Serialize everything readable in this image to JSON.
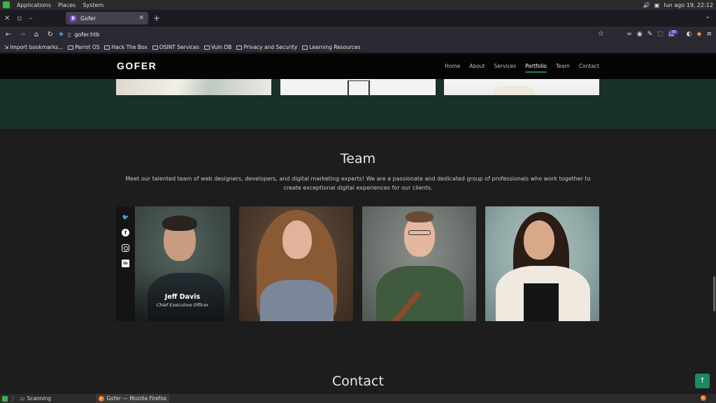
{
  "os_panel": {
    "menu": [
      "Applications",
      "Places",
      "System"
    ],
    "clock": "lun ago 19, 22:12"
  },
  "browser": {
    "tab_title": "Gofer",
    "tab_favicon": "B",
    "url": "gofer.htb",
    "extension_badge": "30",
    "bookmarks": [
      "Import bookmarks...",
      "Parrot OS",
      "Hack The Box",
      "OSINT Services",
      "Vuln DB",
      "Privacy and Security",
      "Learning Resources"
    ]
  },
  "site": {
    "logo": "GOFER",
    "nav": [
      "Home",
      "About",
      "Services",
      "Portfolio",
      "Team",
      "Contact"
    ],
    "active_nav": "Portfolio",
    "team": {
      "title": "Team",
      "description": "Meet our talented team of web designers, developers, and digital marketing experts! We are a passionate and dedicated group of professionals who work together to create exceptional digital experiences for our clients.",
      "members": [
        {
          "name": "Jeff Davis",
          "role": "Chief Executive Officer"
        }
      ],
      "social_icons": [
        "twitter-icon",
        "facebook-icon",
        "instagram-icon",
        "linkedin-icon"
      ]
    },
    "contact_title": "Contact",
    "back_to_top": "↑"
  },
  "taskbar": {
    "items": [
      "Scanning",
      "Gofer — Mozilla Firefox"
    ]
  },
  "colors": {
    "accent_green": "#1a8a5f",
    "portfolio_bg": "#1a302a",
    "header_bg": "#050505"
  }
}
